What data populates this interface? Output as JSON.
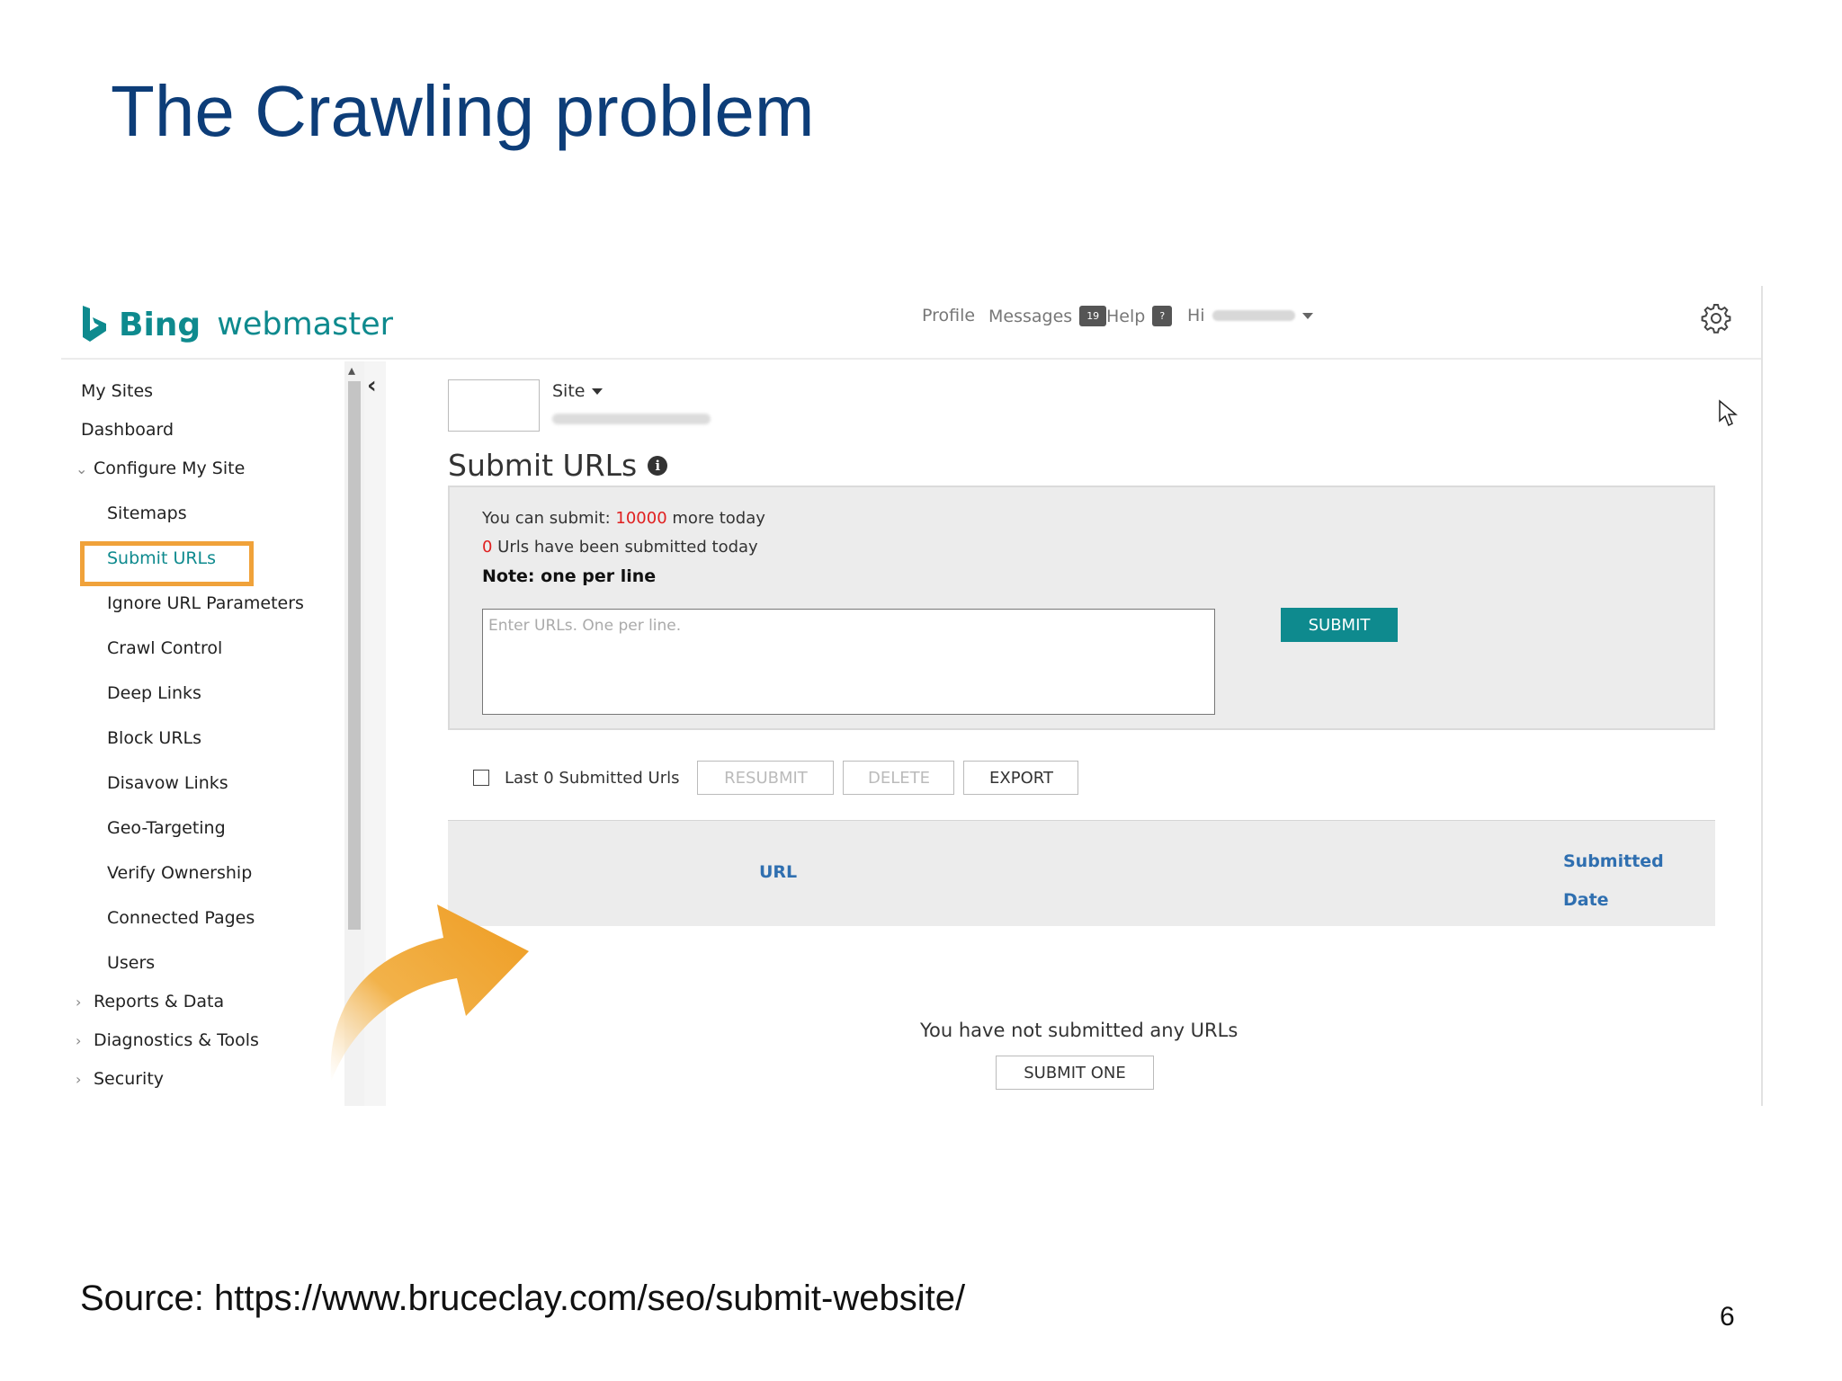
{
  "slide": {
    "title": "The Crawling problem",
    "source": "Source: https://www.bruceclay.com/seo/submit-website/",
    "page_number": "6"
  },
  "header": {
    "brand_bing": "Bing",
    "brand_webmaster": "webmaster",
    "profile": "Profile",
    "messages": "Messages",
    "messages_count": "19",
    "help": "Help",
    "help_badge": "?",
    "greeting": "Hi"
  },
  "sidebar": {
    "items": [
      {
        "label": "My Sites"
      },
      {
        "label": "Dashboard"
      },
      {
        "label": "Configure My Site"
      },
      {
        "label": "Sitemaps"
      },
      {
        "label": "Submit URLs"
      },
      {
        "label": "Ignore URL Parameters"
      },
      {
        "label": "Crawl Control"
      },
      {
        "label": "Deep Links"
      },
      {
        "label": "Block URLs"
      },
      {
        "label": "Disavow Links"
      },
      {
        "label": "Geo-Targeting"
      },
      {
        "label": "Verify Ownership"
      },
      {
        "label": "Connected Pages"
      },
      {
        "label": "Users"
      },
      {
        "label": "Reports & Data"
      },
      {
        "label": "Diagnostics & Tools"
      },
      {
        "label": "Security"
      }
    ]
  },
  "site_selector": {
    "label": "Site"
  },
  "main": {
    "heading": "Submit URLs",
    "quota_prefix": "You can submit: ",
    "quota_value": "10000",
    "quota_suffix": " more today",
    "submitted_count": "0",
    "submitted_suffix": " Urls have been submitted today",
    "note": "Note: one per line",
    "textarea_placeholder": "Enter URLs. One per line.",
    "submit_label": "SUBMIT"
  },
  "toolbar": {
    "last_label": "Last 0 Submitted Urls",
    "resubmit_label": "RESUBMIT",
    "delete_label": "DELETE",
    "export_label": "EXPORT"
  },
  "table": {
    "columns": [
      "URL",
      "Submitted",
      "Date"
    ]
  },
  "empty_state": {
    "message": "You have not submitted any URLs",
    "button_label": "SUBMIT ONE"
  },
  "colors": {
    "brand_teal": "#0e8a8e",
    "title_blue": "#0d3d78",
    "highlight_orange": "#f0a23a",
    "quota_red": "#e02020",
    "column_blue": "#2f6fb0"
  }
}
